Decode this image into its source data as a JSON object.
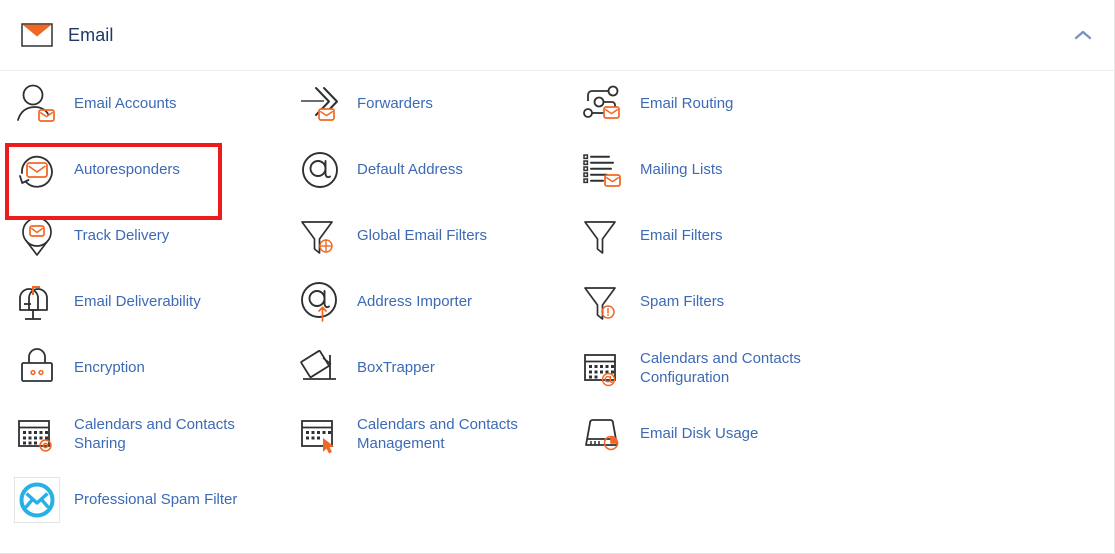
{
  "header": {
    "title": "Email",
    "icon": "envelope-icon",
    "collapse_icon": "chevron-up-icon",
    "collapse_label": "Collapse"
  },
  "colors": {
    "link": "#3c6ab5",
    "title": "#1f3864",
    "accent_orange": "#f26724",
    "icon_stroke": "#2e3033",
    "highlight_red": "#ee1b1b",
    "psf_cyan": "#27b0e6",
    "divider": "#ececec"
  },
  "highlight": {
    "target": "Email Accounts",
    "color": "#ee1b1b"
  },
  "columns": [
    {
      "items": [
        {
          "label": "Email Accounts",
          "icon": "user-envelope-icon"
        },
        {
          "label": "Autoresponders",
          "icon": "envelope-refresh-icon"
        },
        {
          "label": "Track Delivery",
          "icon": "map-pin-envelope-icon"
        },
        {
          "label": "Email Deliverability",
          "icon": "mailbox-icon"
        },
        {
          "label": "Encryption",
          "icon": "lock-icon"
        },
        {
          "label": "Calendars and Contacts Sharing",
          "icon": "calendar-gear-icon"
        },
        {
          "label": "Professional Spam Filter",
          "icon": "spam-filter-circle-icon"
        }
      ]
    },
    {
      "items": [
        {
          "label": "Forwarders",
          "icon": "arrow-envelope-icon"
        },
        {
          "label": "Default Address",
          "icon": "at-sign-icon"
        },
        {
          "label": "Global Email Filters",
          "icon": "funnel-globe-icon"
        },
        {
          "label": "Address Importer",
          "icon": "at-sign-up-arrow-icon"
        },
        {
          "label": "BoxTrapper",
          "icon": "box-trap-icon"
        },
        {
          "label": "Calendars and Contacts Management",
          "icon": "calendar-cursor-icon"
        }
      ]
    },
    {
      "items": [
        {
          "label": "Email Routing",
          "icon": "routing-envelope-icon"
        },
        {
          "label": "Mailing Lists",
          "icon": "list-envelope-icon"
        },
        {
          "label": "Email Filters",
          "icon": "funnel-icon"
        },
        {
          "label": "Spam Filters",
          "icon": "funnel-alert-icon"
        },
        {
          "label": "Calendars and Contacts Configuration",
          "icon": "calendar-at-icon"
        },
        {
          "label": "Email Disk Usage",
          "icon": "disk-pie-icon"
        }
      ]
    }
  ]
}
